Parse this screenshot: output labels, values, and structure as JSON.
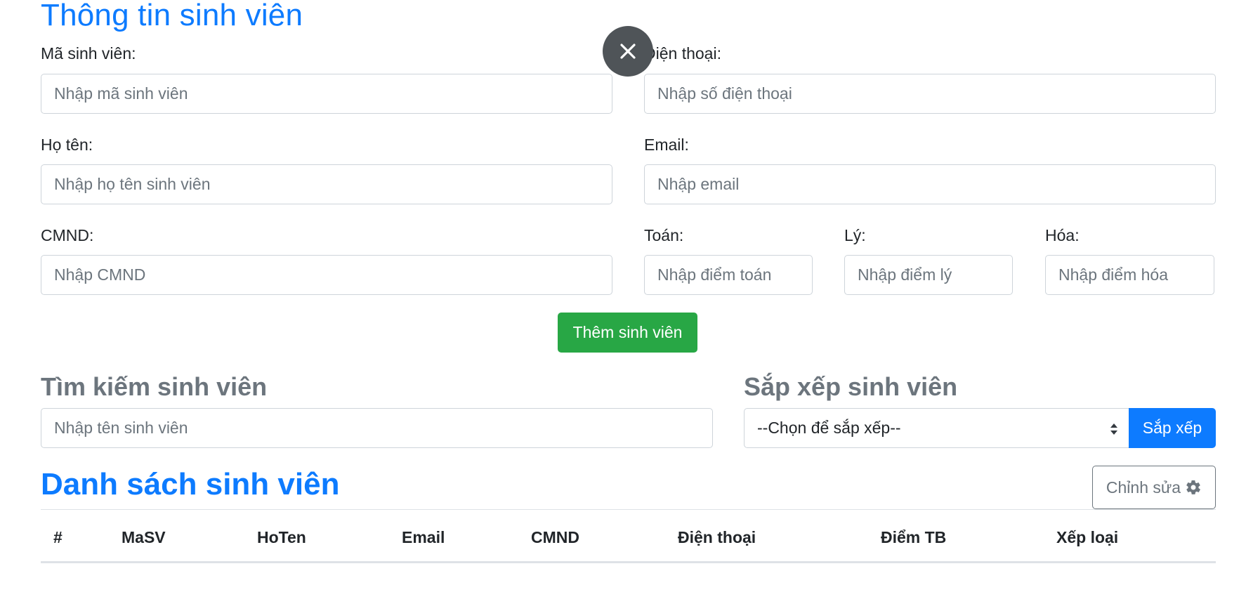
{
  "form": {
    "title": "Thông tin sinh viên",
    "student_id": {
      "label": "Mã sinh viên:",
      "placeholder": "Nhập mã sinh viên",
      "value": ""
    },
    "phone": {
      "label": "Điện thoại:",
      "placeholder": "Nhập số điện thoại",
      "value": ""
    },
    "full_name": {
      "label": "Họ tên:",
      "placeholder": "Nhập họ tên sinh viên",
      "value": ""
    },
    "email": {
      "label": "Email:",
      "placeholder": "Nhập email",
      "value": ""
    },
    "id_card": {
      "label": "CMND:",
      "placeholder": "Nhập CMND",
      "value": ""
    },
    "math": {
      "label": "Toán:",
      "placeholder": "Nhập điểm toán",
      "value": ""
    },
    "physics": {
      "label": "Lý:",
      "placeholder": "Nhập điểm lý",
      "value": ""
    },
    "chemistry": {
      "label": "Hóa:",
      "placeholder": "Nhập điểm hóa",
      "value": ""
    },
    "add_button": "Thêm sinh viên"
  },
  "search": {
    "heading": "Tìm kiếm sinh viên",
    "placeholder": "Nhập tên sinh viên"
  },
  "sort": {
    "heading": "Sắp xếp sinh viên",
    "selected": "--Chọn để sắp xếp--",
    "button": "Sắp xếp"
  },
  "list": {
    "title": "Danh sách sinh viên",
    "edit_button": "Chỉnh sửa",
    "edit_icon": "gear-icon",
    "columns": [
      "#",
      "MaSV",
      "HoTen",
      "Email",
      "CMND",
      "Điện thoại",
      "Điểm TB",
      "Xếp loại"
    ],
    "rows": []
  },
  "overlay": {
    "close_icon": "close-icon"
  },
  "colors": {
    "primary": "#0d7bff",
    "success": "#28a745",
    "secondary": "#6c757d",
    "overlay_button": "#4f5458"
  }
}
